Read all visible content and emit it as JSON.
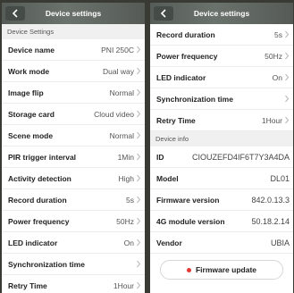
{
  "left": {
    "title": "Device settings",
    "section": "Device Settings",
    "rows": [
      {
        "label": "Device name",
        "value": "PNI 250C"
      },
      {
        "label": "Work mode",
        "value": "Dual way"
      },
      {
        "label": "Image flip",
        "value": "Normal"
      },
      {
        "label": "Storage card",
        "value": "Cloud video"
      },
      {
        "label": "Scene mode",
        "value": "Normal"
      },
      {
        "label": "PIR trigger interval",
        "value": "1Min"
      },
      {
        "label": "Activity detection",
        "value": "High"
      },
      {
        "label": "Record duration",
        "value": "5s"
      },
      {
        "label": "Power frequency",
        "value": "50Hz"
      },
      {
        "label": "LED indicator",
        "value": "On"
      },
      {
        "label": "Synchronization time",
        "value": ""
      },
      {
        "label": "Retry Time",
        "value": "1Hour"
      }
    ]
  },
  "right": {
    "title": "Device settings",
    "rows": [
      {
        "label": "Record duration",
        "value": "5s"
      },
      {
        "label": "Power frequency",
        "value": "50Hz"
      },
      {
        "label": "LED indicator",
        "value": "On"
      },
      {
        "label": "Synchronization time",
        "value": ""
      },
      {
        "label": "Retry Time",
        "value": "1Hour"
      }
    ],
    "info_section": "Device info",
    "info": [
      {
        "label": "ID",
        "value": "CIOUZEFD4IF6T7Y3A4DA"
      },
      {
        "label": "Model",
        "value": "DL01"
      },
      {
        "label": "Firmware version",
        "value": "842.0.13.3"
      },
      {
        "label": "4G module version",
        "value": "50.18.2.14"
      },
      {
        "label": "Vendor",
        "value": "UBIA"
      }
    ],
    "firmware_button": "Firmware update"
  },
  "colors": {
    "header": "#5f6560",
    "accent_dot": "#e53935"
  }
}
